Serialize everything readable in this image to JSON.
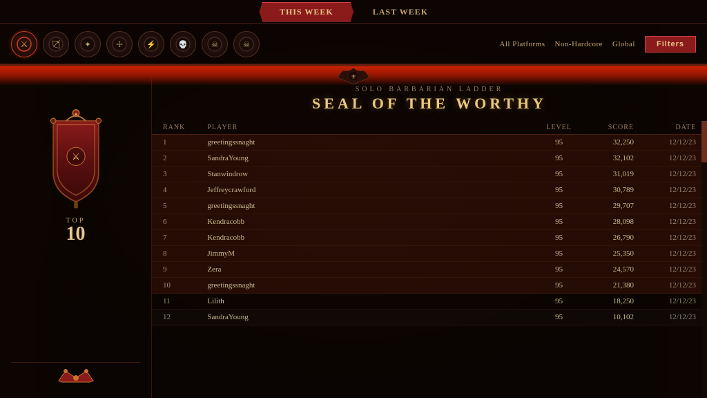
{
  "tabs": {
    "this_week": "THIS WEEK",
    "last_week": "LAST WEEK"
  },
  "filter_labels": {
    "platforms": "All Platforms",
    "mode": "Non-Hardcore",
    "scope": "Global",
    "filters_btn": "Filters"
  },
  "ladder": {
    "subtitle": "Solo Barbarian Ladder",
    "title": "SEAL OF THE WORTHY",
    "badge_top": "TOP",
    "badge_number": "10"
  },
  "table_headers": {
    "rank": "Rank",
    "player": "Player",
    "level": "Level",
    "score": "Score",
    "date": "Date"
  },
  "entries": [
    {
      "rank": "1",
      "player": "greetingssnaght",
      "level": "95",
      "score": "32,250",
      "date": "12/12/23"
    },
    {
      "rank": "2",
      "player": "SandraYoung",
      "level": "95",
      "score": "32,102",
      "date": "12/12/23"
    },
    {
      "rank": "3",
      "player": "Stanwindrow",
      "level": "95",
      "score": "31,019",
      "date": "12/12/23"
    },
    {
      "rank": "4",
      "player": "Jeffreycrawford",
      "level": "95",
      "score": "30,789",
      "date": "12/12/23"
    },
    {
      "rank": "5",
      "player": "greetingssnaght",
      "level": "95",
      "score": "29,707",
      "date": "12/12/23"
    },
    {
      "rank": "6",
      "player": "Kendracobb",
      "level": "95",
      "score": "28,098",
      "date": "12/12/23"
    },
    {
      "rank": "7",
      "player": "Kendracobb",
      "level": "95",
      "score": "26,790",
      "date": "12/12/23"
    },
    {
      "rank": "8",
      "player": "JimmyM",
      "level": "95",
      "score": "25,350",
      "date": "12/12/23"
    },
    {
      "rank": "9",
      "player": "Zera",
      "level": "95",
      "score": "24,570",
      "date": "12/12/23"
    },
    {
      "rank": "10",
      "player": "greetingssnaght",
      "level": "95",
      "score": "21,380",
      "date": "12/12/23"
    },
    {
      "rank": "11",
      "player": "Lilith",
      "level": "95",
      "score": "18,250",
      "date": "12/12/23"
    },
    {
      "rank": "12",
      "player": "SandraYoung",
      "level": "95",
      "score": "10,102",
      "date": "12/12/23"
    }
  ],
  "class_icons": [
    "⚔",
    "🏹",
    "💀",
    "☩",
    "✦",
    "☠",
    "☠",
    "☠"
  ]
}
